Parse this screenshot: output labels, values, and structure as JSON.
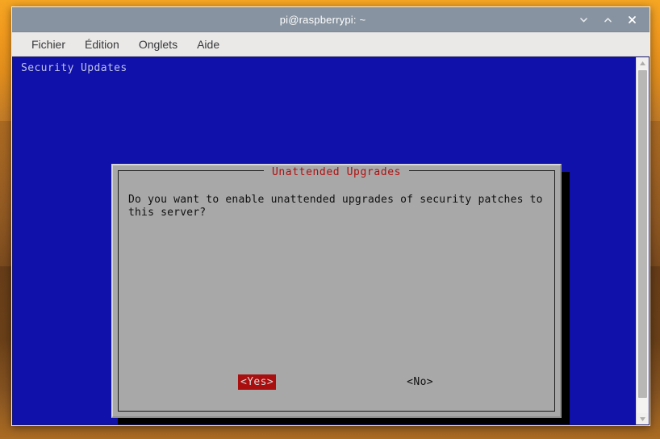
{
  "desktop": {
    "background_top_color": "#f5a623",
    "background_bottom_color": "#7a4a1e"
  },
  "window": {
    "title": "pi@raspberrypi: ~",
    "titlebar_color": "#8793a0",
    "controls": [
      {
        "name": "minimize",
        "icon": "chevron-down-icon",
        "glyph": "v"
      },
      {
        "name": "maximize",
        "icon": "chevron-up-icon",
        "glyph": "^"
      },
      {
        "name": "close",
        "icon": "close-icon",
        "glyph": "X"
      }
    ],
    "menubar": {
      "items": [
        {
          "label": "Fichier"
        },
        {
          "label": "Édition"
        },
        {
          "label": "Onglets"
        },
        {
          "label": "Aide"
        }
      ]
    }
  },
  "terminal": {
    "background_color": "#1010aa",
    "foreground_color": "#bfc4e8",
    "header_line": "Security Updates",
    "scrollbar": {
      "up_arrow_icon": "triangle-up-icon",
      "down_arrow_icon": "triangle-down-icon",
      "thumb_position_percent": 0
    }
  },
  "dialog": {
    "title": "Unattended Upgrades",
    "title_color": "#b01010",
    "background_color": "#a8a8a8",
    "message": "Do you want to enable unattended upgrades of security patches to\nthis server?",
    "buttons": [
      {
        "label": "<Yes>",
        "selected": true,
        "highlight_color": "#aa0f0f",
        "highlight_text_color": "#d8d8d8"
      },
      {
        "label": "<No>",
        "selected": false
      }
    ]
  }
}
